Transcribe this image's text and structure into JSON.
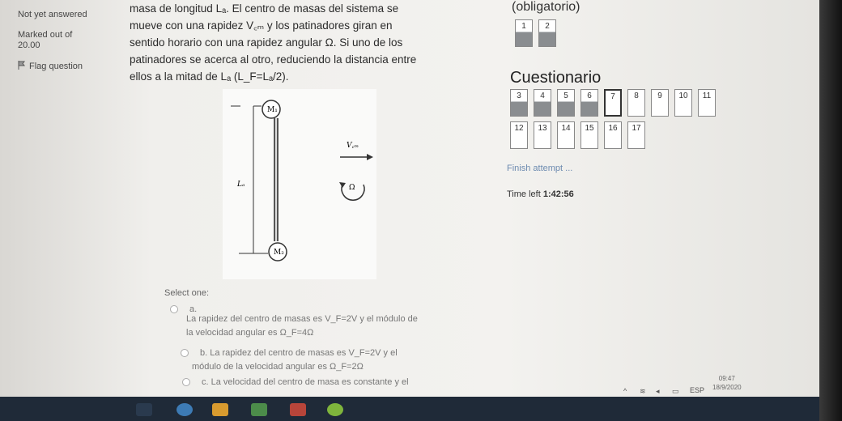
{
  "info": {
    "status": "Not yet answered",
    "marked": "Marked out of",
    "marks": "20.00",
    "flag": "Flag question"
  },
  "question": {
    "lines": [
      "masa de longitud Lₐ. El centro de masas del sistema se",
      "mueve con una rapidez V꜀ₘ y los patinadores giran en",
      "sentido horario con una rapidez angular Ω. Si uno de los",
      "patinadores se acerca al otro, reduciendo la distancia entre",
      "ellos a la mitad de Lₐ (L_F=Lₐ/2)."
    ]
  },
  "figure": {
    "m1": "M₁",
    "m2": "M₂",
    "la": "Lₐ",
    "vcm": "V꜀ₘ",
    "omega": "Ω"
  },
  "nav": {
    "obligatorio": "(obligatorio)",
    "title": "Cuestionario",
    "row0": [
      {
        "n": "1",
        "state": "ans"
      },
      {
        "n": "2",
        "state": "ans"
      }
    ],
    "row1": [
      {
        "n": "3",
        "state": "ans"
      },
      {
        "n": "4",
        "state": "ans"
      },
      {
        "n": "5",
        "state": "ans"
      },
      {
        "n": "6",
        "state": "ans"
      },
      {
        "n": "7",
        "state": "cur"
      },
      {
        "n": "8",
        "state": "open"
      },
      {
        "n": "9",
        "state": "open"
      },
      {
        "n": "10",
        "state": "open"
      },
      {
        "n": "11",
        "state": "open"
      }
    ],
    "row2": [
      {
        "n": "12",
        "state": "open"
      },
      {
        "n": "13",
        "state": "open"
      },
      {
        "n": "14",
        "state": "open"
      },
      {
        "n": "15",
        "state": "open"
      },
      {
        "n": "16",
        "state": "open"
      },
      {
        "n": "17",
        "state": "open"
      }
    ],
    "finish": "Finish attempt ...",
    "time_label": "Time left",
    "time_value": "1:42:56"
  },
  "answers": {
    "select": "Select one:",
    "a_letter": "a.",
    "a_line1": "La rapidez del centro de masas es V_F=2V y el módulo de",
    "a_line2": "la velocidad angular es Ω_F=4Ω",
    "b_line1": "b. La rapidez del centro de masas es V_F=2V y el",
    "b_line2": "módulo de la velocidad angular es Ω_F=2Ω",
    "c_line1": "c. La velocidad del centro de masa es constante y el"
  },
  "tray": {
    "lang": "ESP",
    "time": "09:47",
    "date": "18/9/2020"
  }
}
